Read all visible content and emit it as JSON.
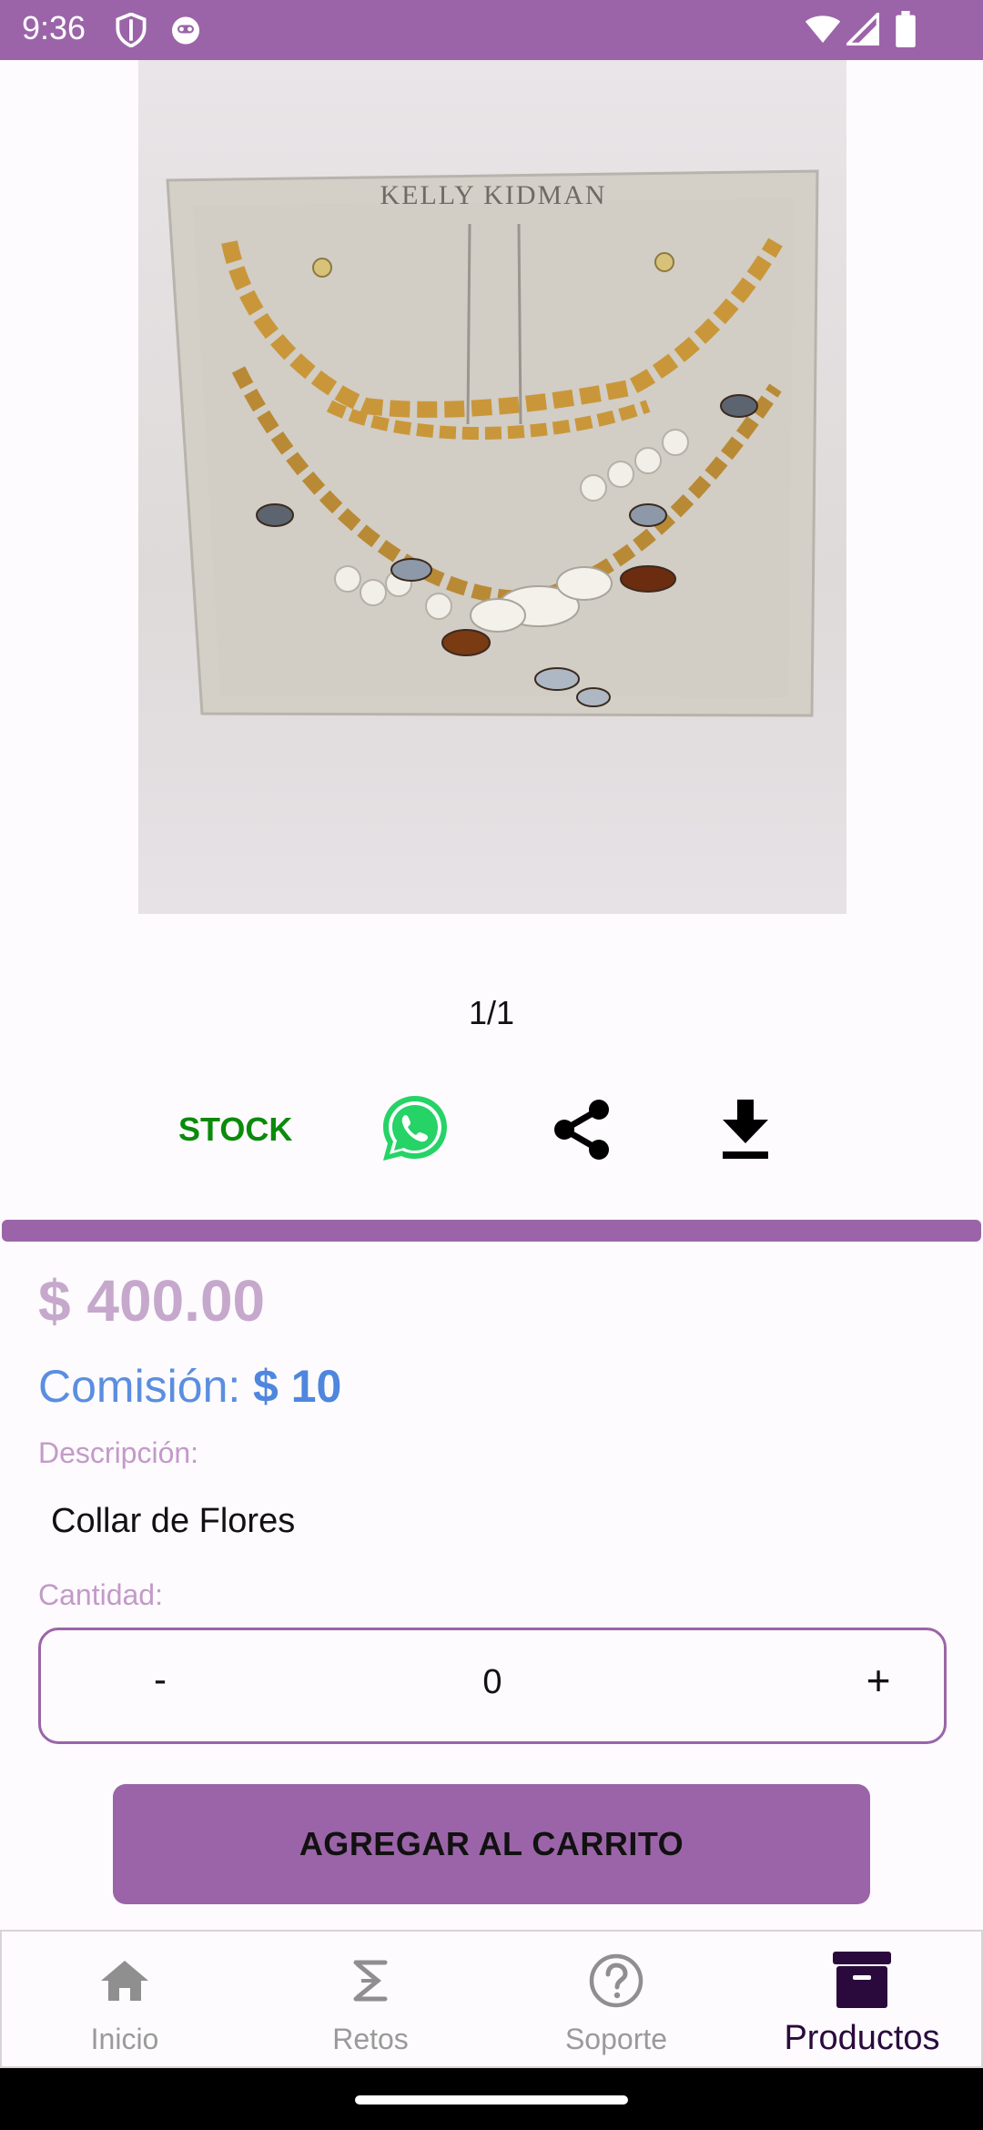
{
  "status_bar": {
    "time": "9:36",
    "icons": [
      "shield-icon",
      "face-icon",
      "wifi-icon",
      "signal-icon",
      "battery-icon"
    ]
  },
  "product": {
    "image_brand": "KELLY KIDMAN",
    "pager": "1/1",
    "stock_label": "STOCK",
    "price": "$ 400.00",
    "commission_label": "Comisión:",
    "commission_value": "$ 10",
    "description_label": "Descripción:",
    "description": "Collar de Flores",
    "quantity_label": "Cantidad:"
  },
  "quantity": {
    "minus": "-",
    "value": "0",
    "plus": "+"
  },
  "cart_button": "AGREGAR AL CARRITO",
  "nav": {
    "items": [
      {
        "label": "Inicio",
        "icon": "home-icon",
        "active": false
      },
      {
        "label": "Retos",
        "icon": "sigma-icon",
        "active": false
      },
      {
        "label": "Soporte",
        "icon": "help-icon",
        "active": false
      },
      {
        "label": "Productos",
        "icon": "archive-icon",
        "active": true
      }
    ]
  },
  "colors": {
    "accent": "#9b64a8",
    "stock": "#0b8a0b",
    "whatsapp": "#25d366",
    "price": "#c6a8cc",
    "commission": "#4f86de",
    "nav_active": "#2a0a3c"
  }
}
